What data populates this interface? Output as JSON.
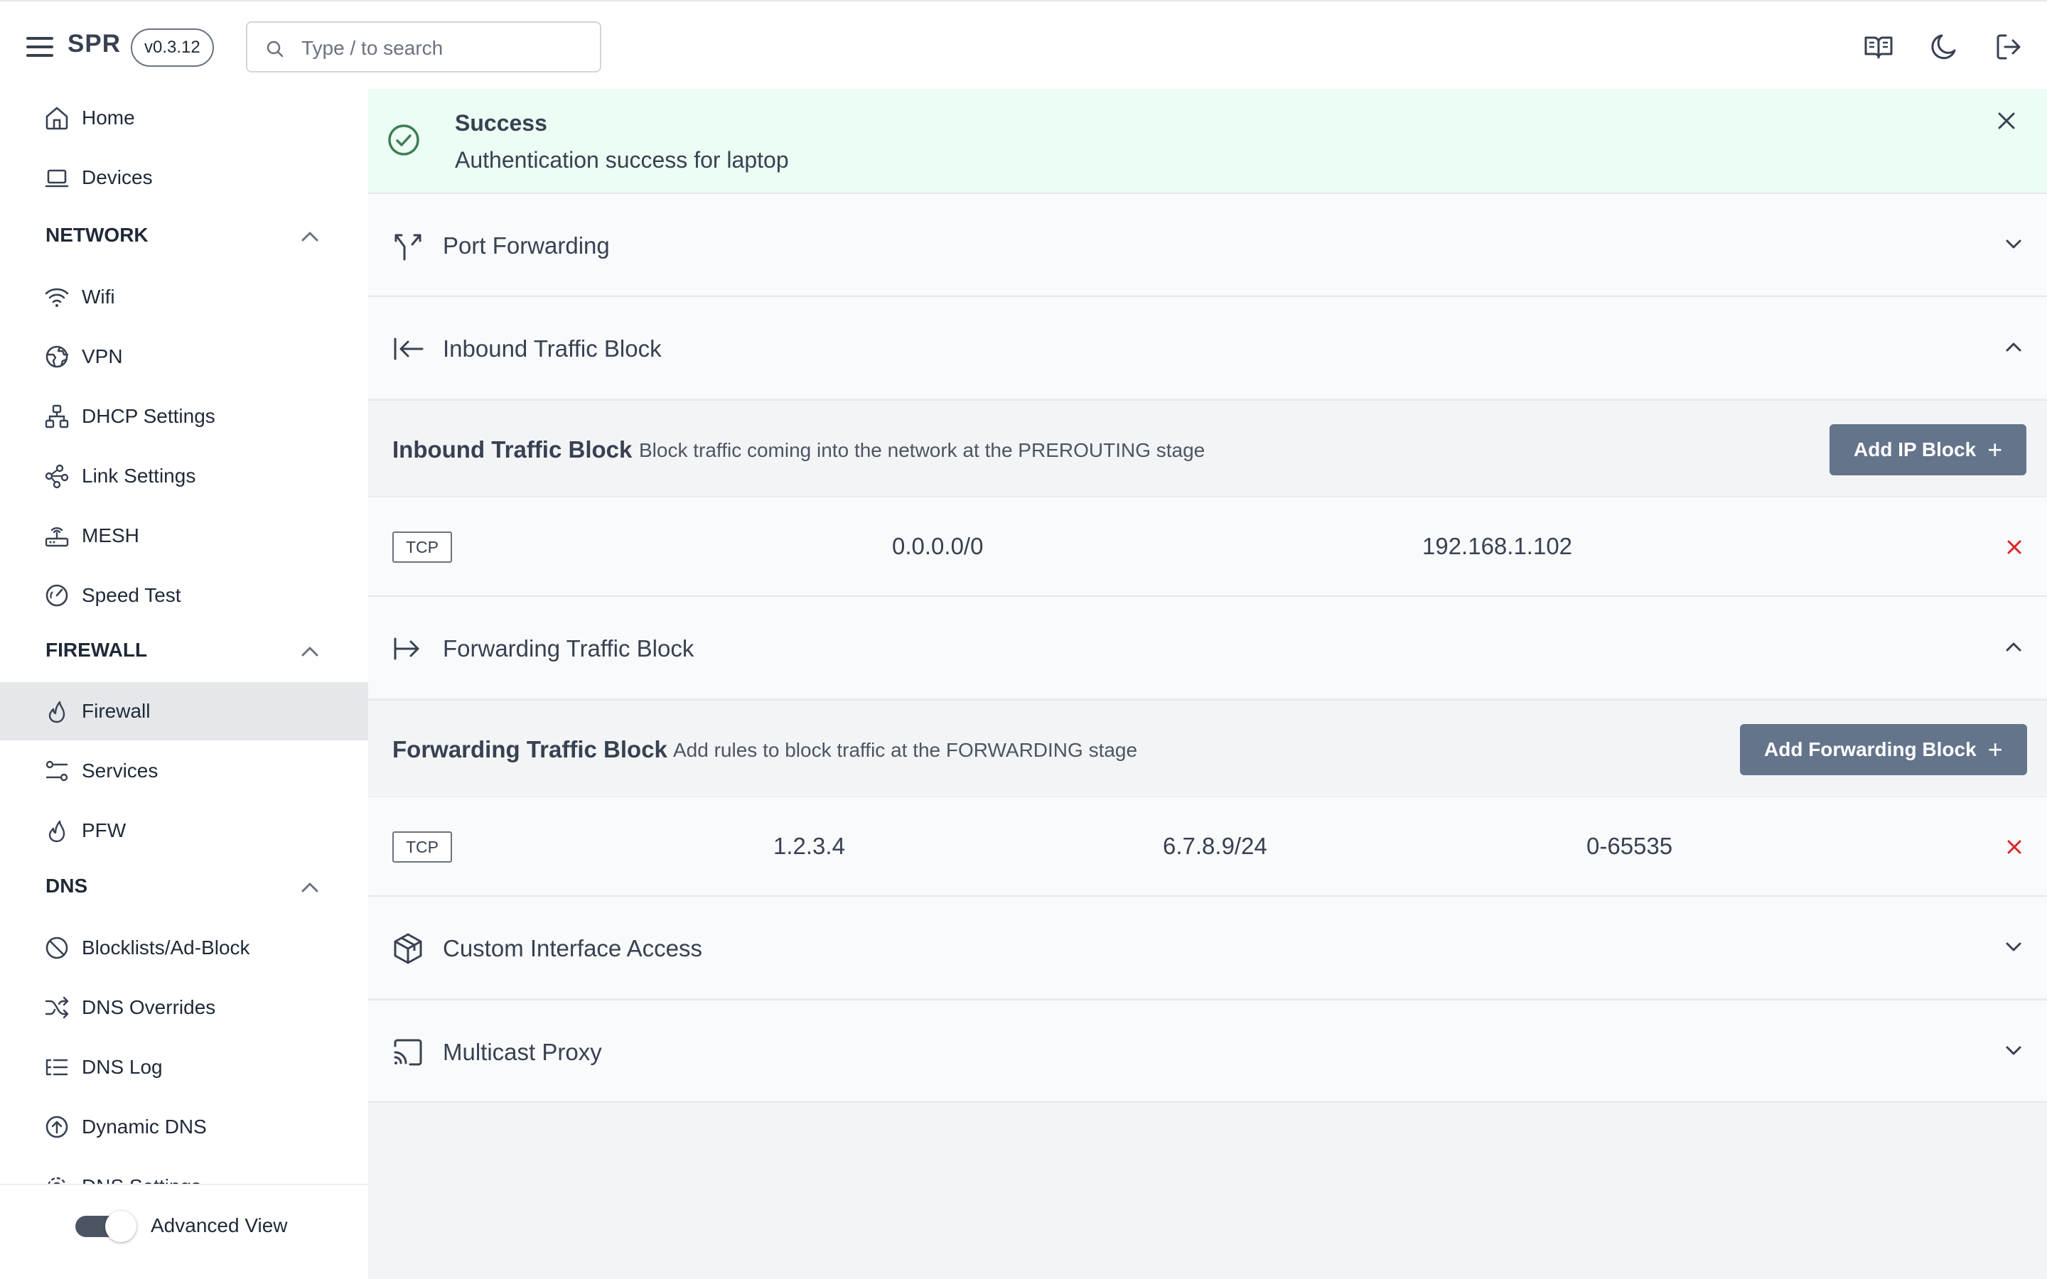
{
  "header": {
    "brand": "SPR",
    "version": "v0.3.12",
    "search_placeholder": "Type / to search",
    "icons": [
      "menu-icon",
      "book-icon",
      "moon-icon",
      "logout-icon"
    ]
  },
  "sidebar": {
    "items_top": [
      {
        "label": "Home",
        "icon": "home-icon"
      },
      {
        "label": "Devices",
        "icon": "laptop-icon"
      }
    ],
    "network": {
      "title": "NETWORK",
      "items": [
        {
          "label": "Wifi",
          "icon": "wifi-icon"
        },
        {
          "label": "VPN",
          "icon": "globe-icon"
        },
        {
          "label": "DHCP Settings",
          "icon": "network-icon"
        },
        {
          "label": "Link Settings",
          "icon": "link-icon"
        },
        {
          "label": "MESH",
          "icon": "router-icon"
        },
        {
          "label": "Speed Test",
          "icon": "gauge-icon"
        }
      ]
    },
    "firewall": {
      "title": "FIREWALL",
      "items": [
        {
          "label": "Firewall",
          "icon": "flame-icon",
          "active": true
        },
        {
          "label": "Services",
          "icon": "services-icon"
        },
        {
          "label": "PFW",
          "icon": "flame-icon"
        }
      ]
    },
    "dns": {
      "title": "DNS",
      "items": [
        {
          "label": "Blocklists/Ad-Block",
          "icon": "ban-icon"
        },
        {
          "label": "DNS Overrides",
          "icon": "shuffle-icon"
        },
        {
          "label": "DNS Log",
          "icon": "list-icon"
        },
        {
          "label": "Dynamic DNS",
          "icon": "upload-circle-icon"
        },
        {
          "label": "DNS Settings",
          "icon": "settings-icon"
        }
      ]
    },
    "footer": {
      "toggle_label": "Advanced View",
      "toggle_on": true
    }
  },
  "toast": {
    "title": "Success",
    "message": "Authentication success for laptop"
  },
  "sections": {
    "port_forwarding": {
      "label": "Port Forwarding",
      "expanded": false
    },
    "inbound": {
      "label": "Inbound Traffic Block",
      "expanded": true,
      "panel_title": "Inbound Traffic Block",
      "panel_desc": "Block traffic coming into the network at the PREROUTING stage",
      "button": "Add IP Block",
      "rows": [
        {
          "protocol": "TCP",
          "src": "0.0.0.0/0",
          "dst": "192.168.1.102"
        }
      ]
    },
    "forwarding": {
      "label": "Forwarding Traffic Block",
      "expanded": true,
      "panel_title": "Forwarding Traffic Block",
      "panel_desc": "Add rules to block traffic at the FORWARDING stage",
      "button": "Add Forwarding Block",
      "rows": [
        {
          "protocol": "TCP",
          "src": "1.2.3.4",
          "dst": "6.7.8.9/24",
          "ports": "0-65535"
        }
      ]
    },
    "custom_interface": {
      "label": "Custom Interface Access",
      "expanded": false
    },
    "multicast": {
      "label": "Multicast Proxy",
      "expanded": false
    }
  },
  "colors": {
    "success_bg": "#ecfdf3",
    "success_icon": "#3f7d56",
    "button_bg": "#64748b",
    "delete": "#dc2626",
    "active_nav": "#e5e7eb"
  }
}
